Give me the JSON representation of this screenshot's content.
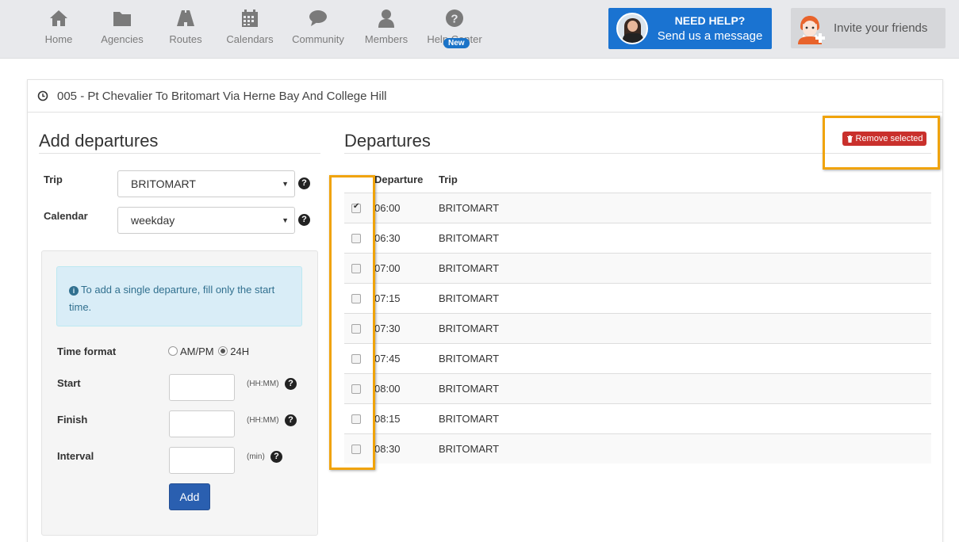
{
  "nav": {
    "items": [
      {
        "label": "Home",
        "icon": "home-icon"
      },
      {
        "label": "Agencies",
        "icon": "folder-icon"
      },
      {
        "label": "Routes",
        "icon": "road-icon"
      },
      {
        "label": "Calendars",
        "icon": "calendar-icon"
      },
      {
        "label": "Community",
        "icon": "chat-icon"
      },
      {
        "label": "Members",
        "icon": "user-icon"
      },
      {
        "label": "Help Center",
        "icon": "question-icon"
      }
    ],
    "new_badge": "New",
    "help_title": "NEED HELP?",
    "help_subtitle": "Send us a message",
    "invite_label": "Invite your friends"
  },
  "route": {
    "title": "005 - Pt Chevalier To Britomart Via Herne Bay And College Hill"
  },
  "add_form": {
    "heading": "Add departures",
    "trip_label": "Trip",
    "trip_value": "BRITOMART",
    "calendar_label": "Calendar",
    "calendar_value": "weekday",
    "info_text": "To add a single departure, fill only the start time.",
    "time_format_label": "Time format",
    "ampm_label": "AM/PM",
    "h24_label": "24H",
    "start_label": "Start",
    "finish_label": "Finish",
    "interval_label": "Interval",
    "hhmm_hint": "(HH:MM)",
    "min_hint": "(min)",
    "add_button": "Add"
  },
  "departures": {
    "heading": "Departures",
    "remove_button": "Remove selected",
    "col_departure": "Departure",
    "col_trip": "Trip",
    "rows": [
      {
        "time": "06:00",
        "trip": "BRITOMART",
        "checked": true
      },
      {
        "time": "06:30",
        "trip": "BRITOMART",
        "checked": false
      },
      {
        "time": "07:00",
        "trip": "BRITOMART",
        "checked": false
      },
      {
        "time": "07:15",
        "trip": "BRITOMART",
        "checked": false
      },
      {
        "time": "07:30",
        "trip": "BRITOMART",
        "checked": false
      },
      {
        "time": "07:45",
        "trip": "BRITOMART",
        "checked": false
      },
      {
        "time": "08:00",
        "trip": "BRITOMART",
        "checked": false
      },
      {
        "time": "08:15",
        "trip": "BRITOMART",
        "checked": false
      },
      {
        "time": "08:30",
        "trip": "BRITOMART",
        "checked": false
      }
    ]
  },
  "colors": {
    "primary": "#1a73d1",
    "danger": "#c9302c",
    "highlight": "#f0a30a",
    "info_bg": "#d9edf7"
  }
}
